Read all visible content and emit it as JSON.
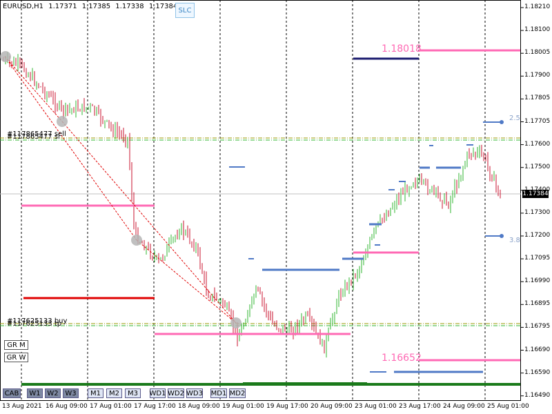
{
  "header": {
    "symbol": "EURUSD,H1",
    "open": "1.17371",
    "high": "1.17385",
    "low": "1.17338",
    "close": "1.17384"
  },
  "slc_button": "SLC",
  "price_axis": [
    "1.18210",
    "1.18100",
    "1.18005",
    "1.17900",
    "1.17805",
    "1.17705",
    "1.17600",
    "1.17500",
    "1.17400",
    "1.17300",
    "1.17200",
    "1.17095",
    "1.16990",
    "1.16895",
    "1.16795",
    "1.16690",
    "1.16590",
    "1.16490"
  ],
  "current_price": "1.17384",
  "time_axis": [
    "13 Aug 2021",
    "16 Aug 09:00",
    "17 Aug 01:00",
    "17 Aug 17:00",
    "18 Aug 09:00",
    "19 Aug 01:00",
    "19 Aug 17:00",
    "20 Aug 09:00",
    "23 Aug 01:00",
    "23 Aug 17:00",
    "24 Aug 09:00",
    "25 Aug 01:00"
  ],
  "levels": {
    "upper_label": "1.18018",
    "lower_label": "1.16652"
  },
  "trade_tags": {
    "sell": "#117865477 sell",
    "sell_overlap": "#117865477 sl",
    "buy": "#117625133 buy",
    "buy_overlap": "#117625133 tp"
  },
  "ratios": {
    "upper": "2.5",
    "lower": "3.8"
  },
  "gr_buttons": [
    "GR M",
    "GR W"
  ],
  "tf_buttons": [
    "CAB",
    "W1",
    "W2",
    "W3",
    "M1",
    "M2",
    "M3",
    "WD1",
    "WD2",
    "WD3",
    "MD1",
    "MD2"
  ],
  "colors": {
    "bull": "#2fb52f",
    "bear": "#c8102e",
    "pink": "#ff69b4",
    "navy": "#1a1a6e",
    "blue": "#4f79c6",
    "red": "#e00000",
    "green": "#1a7a1a",
    "olive": "#9a9a00"
  }
}
